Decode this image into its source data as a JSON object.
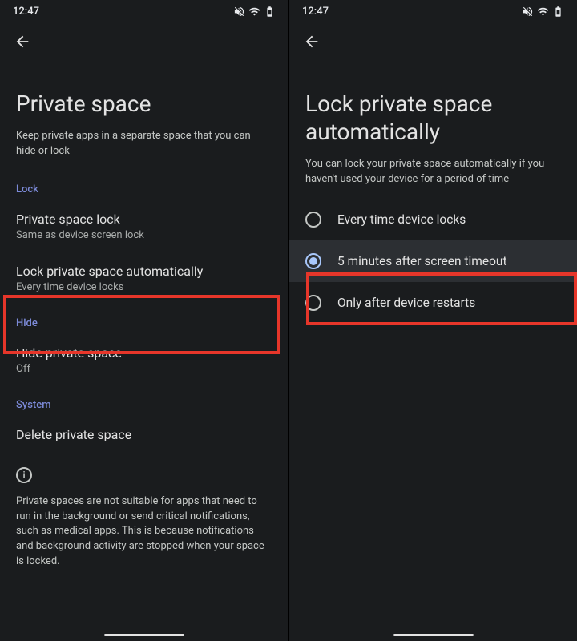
{
  "status": {
    "time": "12:47"
  },
  "left": {
    "title": "Private space",
    "subtitle": "Keep private apps in a separate space that you can hide or lock",
    "sections": {
      "lock": {
        "label": "Lock",
        "items": [
          {
            "title": "Private space lock",
            "sub": "Same as device screen lock"
          },
          {
            "title": "Lock private space automatically",
            "sub": "Every time device locks"
          }
        ]
      },
      "hide": {
        "label": "Hide",
        "items": [
          {
            "title": "Hide private space",
            "sub": "Off"
          }
        ]
      },
      "system": {
        "label": "System",
        "items": [
          {
            "title": "Delete private space"
          }
        ]
      }
    },
    "info_text": "Private spaces are not suitable for apps that need to run in the background or send critical notifications, such as medical apps. This is because notifications and background activity are stopped when your space is locked."
  },
  "right": {
    "title": "Lock private space automatically",
    "subtitle": "You can lock your private space automatically if you haven't used your device for a period of time",
    "options": [
      {
        "label": "Every time device locks",
        "selected": false
      },
      {
        "label": "5 minutes after screen timeout",
        "selected": true
      },
      {
        "label": "Only after device restarts",
        "selected": false
      }
    ]
  }
}
